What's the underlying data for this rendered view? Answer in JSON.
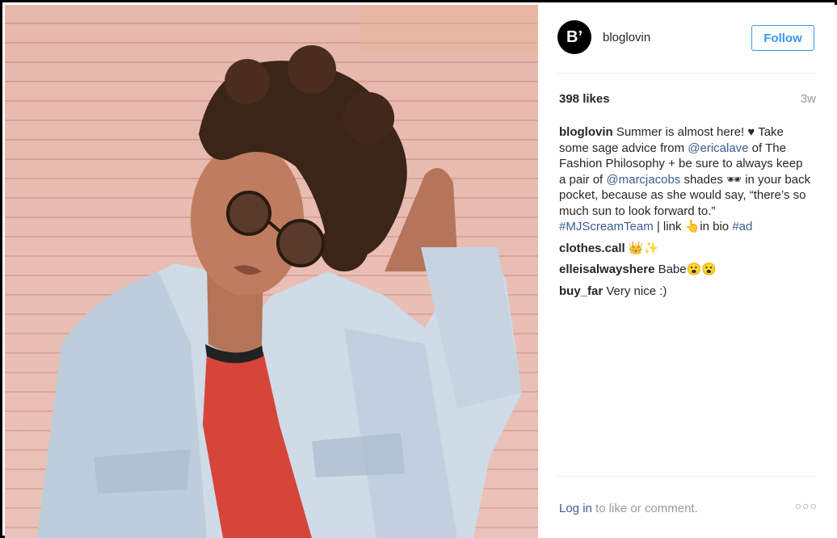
{
  "post": {
    "image_alt": "Woman with curly hair in round sunglasses and denim jacket in front of brick wall"
  },
  "header": {
    "avatar_text": "B’",
    "username": "bloglovin",
    "follow_label": "Follow"
  },
  "stats": {
    "likes": "398 likes",
    "time": "3w"
  },
  "caption": {
    "author": "bloglovin",
    "t1": " Summer is almost here! ♥ Take some sage advice from ",
    "m1": "@ericalave",
    "t2": " of The Fashion Philosophy + be sure to always keep a pair of ",
    "m2": "@marcjacobs",
    "t3": " shades 🕶 in your back pocket, because as she would say, “there’s so much sun to look forward to.” ",
    "h1": "#MJScreamTeam",
    "t4": " | link 👆in bio ",
    "h2": "#ad"
  },
  "comments": [
    {
      "author": "clothes.call",
      "text": " 👑✨"
    },
    {
      "author": "elleisalwayshere",
      "text": " Babe😮😮"
    },
    {
      "author": "buy_far",
      "text": " Very nice :)"
    }
  ],
  "footer": {
    "login_link": "Log in",
    "login_rest": " to like or comment.",
    "more_label": "○○○"
  },
  "colors": {
    "accent": "#3897f0",
    "link": "#3b5d8f",
    "muted": "#999999"
  }
}
